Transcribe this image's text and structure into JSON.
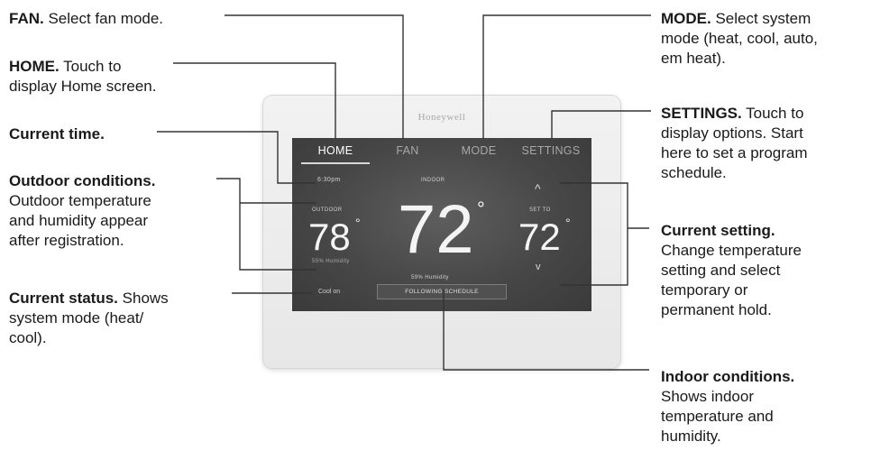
{
  "callouts": {
    "fan": {
      "title": "FAN.",
      "text": " Select fan mode."
    },
    "home": {
      "title": "HOME.",
      "line1": " Touch to",
      "line2": "display Home screen."
    },
    "time": {
      "title": "Current time."
    },
    "outdoor": {
      "title": "Outdoor conditions.",
      "line1": "Outdoor temperature",
      "line2": "and humidity appear",
      "line3": "after registration."
    },
    "status": {
      "title": "Current status.",
      "line1": " Shows",
      "line2": "system mode (heat/",
      "line3": "cool)."
    },
    "mode": {
      "title": "MODE.",
      "line1": " Select system",
      "line2": "mode (heat, cool, auto,",
      "line3": "em heat)."
    },
    "settings": {
      "title": "SETTINGS.",
      "line1": " Touch to",
      "line2": "display options. Start",
      "line3": "here to set a program",
      "line4": "schedule."
    },
    "setting": {
      "title": "Current setting.",
      "line1": "Change temperature",
      "line2": "setting and select",
      "line3": "temporary or",
      "line4": "permanent hold."
    },
    "indoor": {
      "title": "Indoor conditions.",
      "line1": "Shows indoor",
      "line2": "temperature and",
      "line3": "humidity."
    }
  },
  "device": {
    "brand": "Honeywell",
    "tabs": {
      "home": "HOME",
      "fan": "FAN",
      "mode": "MODE",
      "settings": "SETTINGS"
    },
    "time": "6:30pm",
    "indoor_label": "INDOOR",
    "outdoor_label": "OUTDOOR",
    "outdoor_temp": "78",
    "outdoor_humidity": "55% Humidity",
    "indoor_temp": "72",
    "indoor_humidity": "59% Humidity",
    "set_to_label": "SET TO",
    "set_temp": "72",
    "degree": "°",
    "up_arrow": "^",
    "down_arrow": "v",
    "status": "Cool on",
    "schedule": "FOLLOWING SCHEDULE"
  },
  "colors": {
    "screen": "#474747",
    "bezel": "#ececec",
    "leader": "#333333",
    "text": "#1a1a1a"
  }
}
